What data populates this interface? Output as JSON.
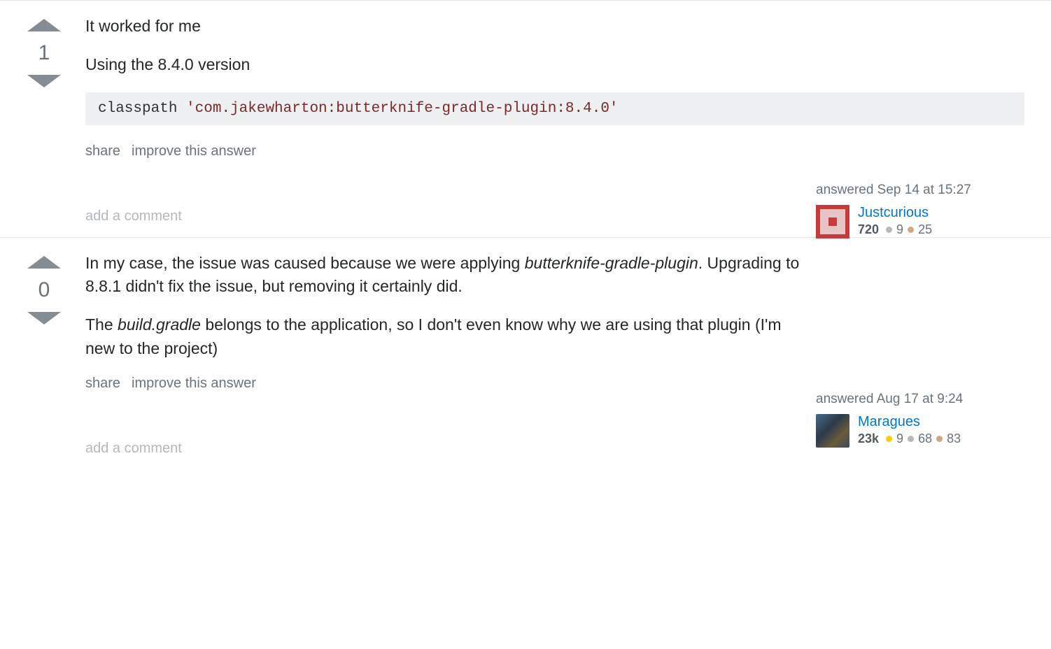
{
  "answers": [
    {
      "score": "1",
      "paragraphs": [
        [
          {
            "t": "It worked for me"
          }
        ],
        [
          {
            "t": "Using the 8.4.0 version"
          }
        ]
      ],
      "code": {
        "kw": "classpath ",
        "str": "'com.jakewharton:butterknife-gradle-plugin:8.4.0'"
      },
      "share": "share",
      "improve": "improve this answer",
      "answered_prefix": "answered ",
      "answered_time": "Sep 14 at 15:27",
      "user": {
        "name": "Justcurious",
        "rep": "720",
        "silver": "9",
        "bronze": "25"
      },
      "add_comment": "add a comment",
      "uc_top": "240"
    },
    {
      "score": "0",
      "paragraphs": [
        [
          {
            "t": "In my case, the issue was caused because we were applying "
          },
          {
            "t": "butterknife-gradle-plugin",
            "i": true
          },
          {
            "t": ". Upgrading to 8.8.1 didn't fix the issue, but removing it certainly did."
          }
        ],
        [
          {
            "t": "The "
          },
          {
            "t": "build.gradle",
            "i": true
          },
          {
            "t": " belongs to the application, so I don't even know why we are using that plugin (I'm new to the project)"
          }
        ]
      ],
      "share": "share",
      "improve": "improve this answer",
      "answered_prefix": "answered ",
      "answered_time": "Aug 17 at 9:24",
      "user": {
        "name": "Maragues",
        "rep": "23k",
        "gold": "9",
        "silver": "68",
        "bronze": "83"
      },
      "add_comment": "add a comment",
      "uc_top": "200"
    }
  ]
}
